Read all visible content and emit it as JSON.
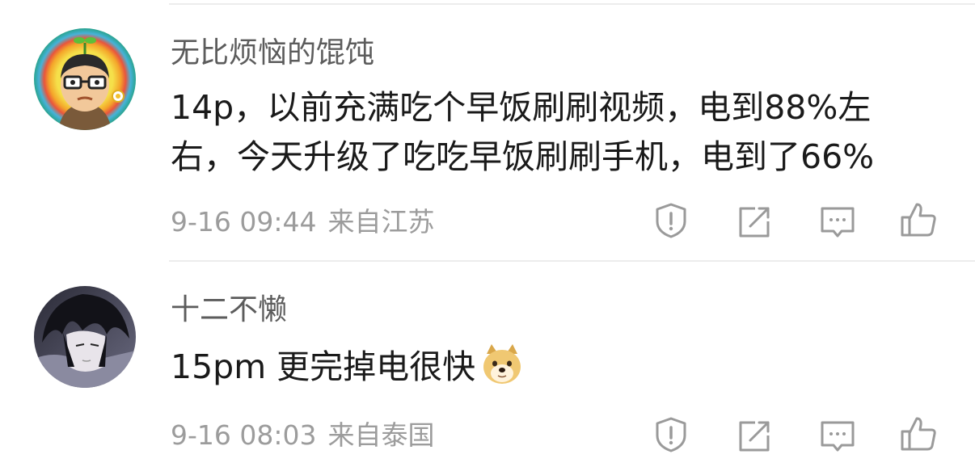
{
  "comments": [
    {
      "username": "无比烦恼的馄饨",
      "line1": "14p，以前充满吃个早饭刷刷视频，电到88%左",
      "line2": "右，今天升级了吃吃早饭刷刷手机，电到了66%",
      "time": "9-16 09:44",
      "location": "来自江苏",
      "avatar_icon": "cartoon-boy-avatar"
    },
    {
      "username": "十二不懒",
      "text": "15pm 更完掉电很快",
      "emoji_icon": "doge-emoji",
      "time": "9-16 08:03",
      "location": "来自泰国",
      "avatar_icon": "anime-boy-avatar"
    }
  ],
  "action_icons": [
    "report-icon",
    "share-icon",
    "comment-icon",
    "like-icon"
  ],
  "colors": {
    "username": "#5c5c5c",
    "text": "#1a1a1a",
    "meta": "#9c9c9c",
    "icon": "#9a9a9a"
  }
}
